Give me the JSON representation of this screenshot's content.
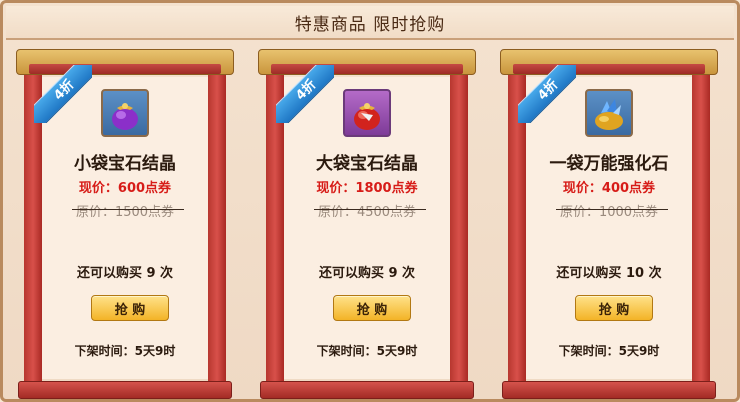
{
  "header": {
    "title": "特惠商品  限时抢购"
  },
  "items": [
    {
      "badge": "4折",
      "name": "小袋宝石结晶",
      "price_now": "现价：600点券",
      "price_old": "原价：1500点券",
      "remaining": "还可以购买 9 次",
      "buy_label": "抢 购",
      "off_time": "下架时间：5天9时",
      "icon": "purple-gem-bag-icon"
    },
    {
      "badge": "4折",
      "name": "大袋宝石结晶",
      "price_now": "现价：1800点券",
      "price_old": "原价：4500点券",
      "remaining": "还可以购买 9 次",
      "buy_label": "抢 购",
      "off_time": "下架时间：5天9时",
      "icon": "red-gem-bag-icon"
    },
    {
      "badge": "4折",
      "name": "一袋万能强化石",
      "price_now": "现价：400点券",
      "price_old": "原价：1000点券",
      "remaining": "还可以购买 10 次",
      "buy_label": "抢 购",
      "off_time": "下架时间：5天9时",
      "icon": "gold-crystal-bag-icon"
    }
  ],
  "colors": {
    "price_now": "#d71c18",
    "badge": "#2a8ad8",
    "pillar": "#c2403a",
    "button": "#f3b327"
  }
}
